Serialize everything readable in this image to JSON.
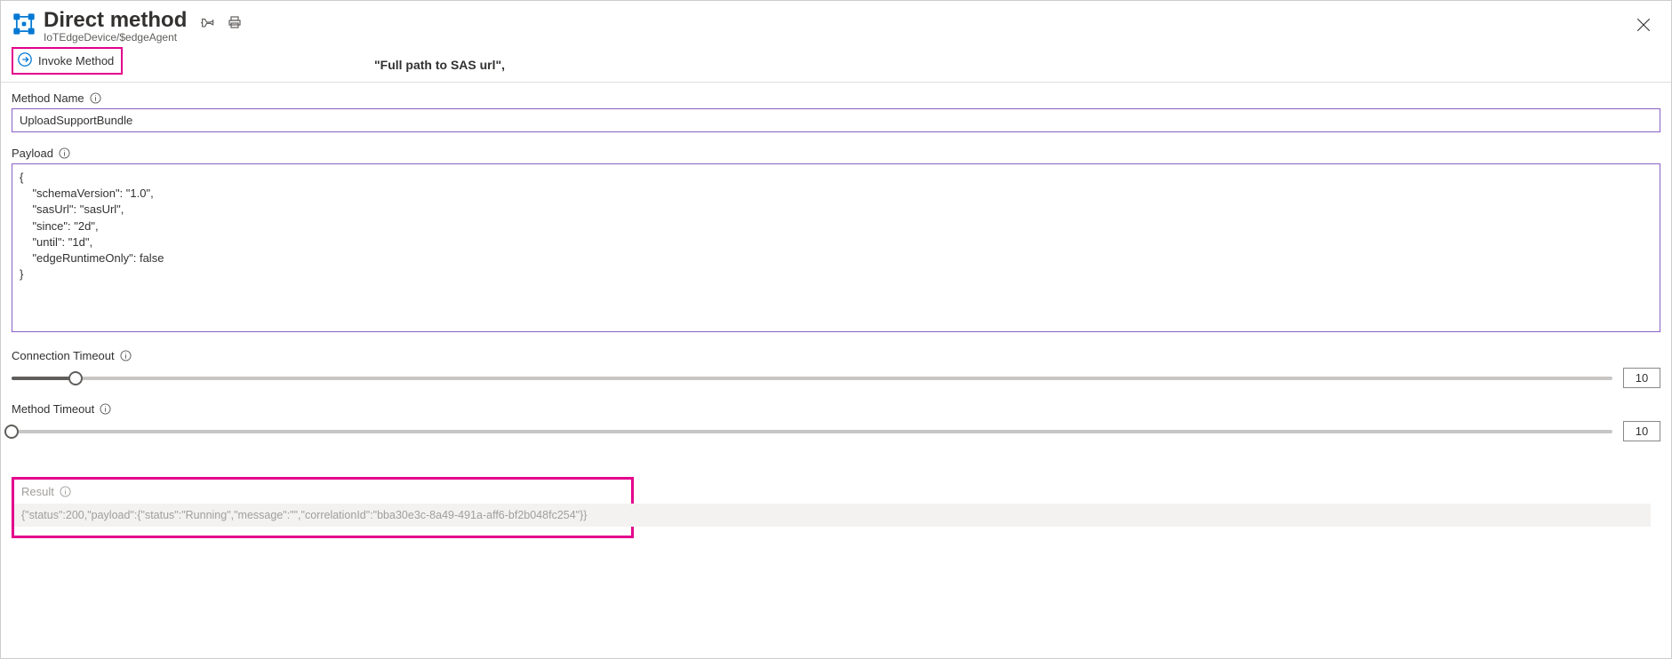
{
  "header": {
    "title": "Direct method",
    "breadcrumb": "IoTEdgeDevice/$edgeAgent",
    "floating_hint": "\"Full path to SAS url\","
  },
  "toolbar": {
    "invoke_label": "Invoke Method"
  },
  "method_name": {
    "label": "Method Name",
    "value": "UploadSupportBundle"
  },
  "payload": {
    "label": "Payload",
    "value": "{\n    \"schemaVersion\": \"1.0\",\n    \"sasUrl\": \"sasUrl\",\n    \"since\": \"2d\",\n    \"until\": \"1d\",\n    \"edgeRuntimeOnly\": false\n}"
  },
  "connection_timeout": {
    "label": "Connection Timeout",
    "value": "10",
    "fill_percent": 4
  },
  "method_timeout": {
    "label": "Method Timeout",
    "value": "10",
    "fill_percent": 0
  },
  "result": {
    "label": "Result",
    "value": "{\"status\":200,\"payload\":{\"status\":\"Running\",\"message\":\"\",\"correlationId\":\"bba30e3c-8a49-491a-aff6-bf2b048fc254\"}}"
  }
}
